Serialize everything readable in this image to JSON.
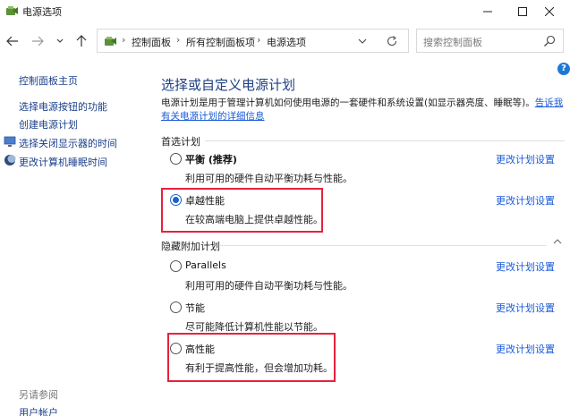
{
  "window": {
    "title": "电源选项",
    "icons": {
      "app": "power-options-icon",
      "minimize": "minimize-icon",
      "maximize": "maximize-icon",
      "close": "close-icon"
    }
  },
  "nav": {
    "breadcrumbs": [
      "控制面板",
      "所有控制面板项",
      "电源选项"
    ],
    "search_placeholder": "搜索控制面板"
  },
  "sidebar": {
    "home": "控制面板主页",
    "links": [
      {
        "label": "选择电源按钮的功能",
        "icon": ""
      },
      {
        "label": "创建电源计划",
        "icon": ""
      },
      {
        "label": "选择关闭显示器的时间",
        "icon": "display-shield-icon"
      },
      {
        "label": "更改计算机睡眠时间",
        "icon": "moon-icon"
      }
    ],
    "see_also_title": "另请参阅",
    "see_also_links": [
      "用户帐户"
    ]
  },
  "main": {
    "title": "选择或自定义电源计划",
    "description": "电源计划是用于管理计算机如何使用电源的一套硬件和系统设置(如显示器亮度、睡眠等)。",
    "description_link": "告诉我有关电源计划的详细信息",
    "preferred_section": "首选计划",
    "hidden_section": "隐藏附加计划",
    "change_link": "更改计划设置",
    "plans": [
      {
        "name": "平衡 (推荐)",
        "description": "利用可用的硬件自动平衡功耗与性能。",
        "selected": false,
        "highlighted": false
      },
      {
        "name": "卓越性能",
        "description": "在较高端电脑上提供卓越性能。",
        "selected": true,
        "highlighted": true
      },
      {
        "name": "Parallels",
        "description": "利用可用的硬件自动平衡功耗与性能。",
        "selected": false,
        "highlighted": false
      },
      {
        "name": "节能",
        "description": "尽可能降低计算机性能以节能。",
        "selected": false,
        "highlighted": false
      },
      {
        "name": "高性能",
        "description": "有利于提高性能，但会增加功耗。",
        "selected": false,
        "highlighted": true
      }
    ]
  },
  "colors": {
    "highlight": "#e8213d",
    "link": "#1a5bd8",
    "title": "#1e3f83"
  }
}
